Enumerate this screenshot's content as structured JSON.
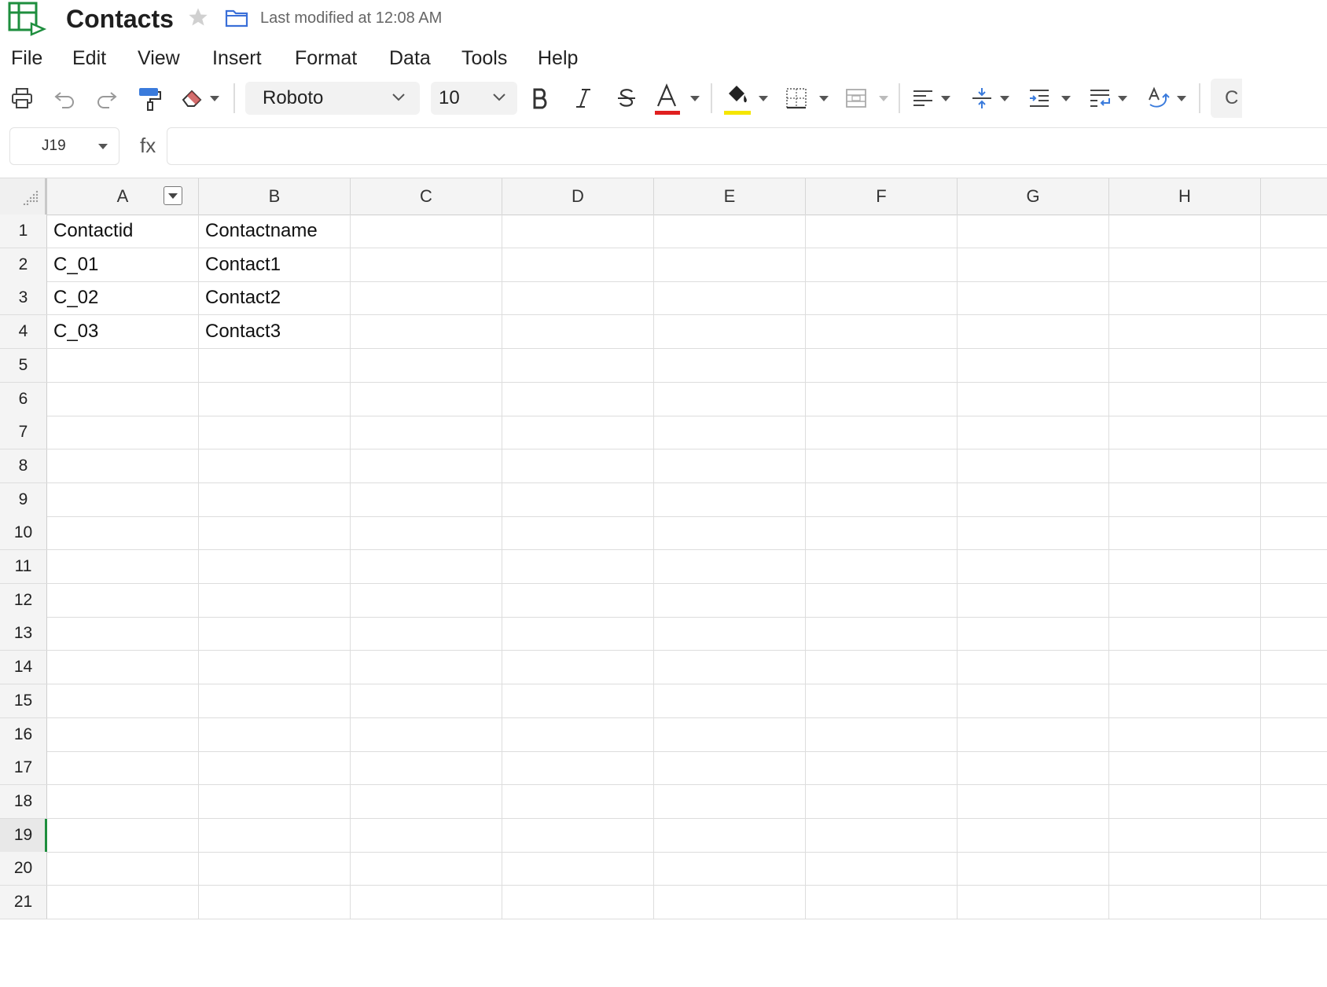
{
  "document": {
    "title": "Contacts",
    "last_modified": "Last modified at 12:08 AM"
  },
  "menu": [
    "File",
    "Edit",
    "View",
    "Insert",
    "Format",
    "Data",
    "Tools",
    "Help"
  ],
  "toolbar": {
    "font_family": "Roboto",
    "font_size": "10",
    "text_color": "#e02020",
    "fill_color": "#f5e600",
    "partial_right_edge": "C"
  },
  "formula_bar": {
    "cell_ref": "J19",
    "fx_label": "fx",
    "formula": ""
  },
  "sheet": {
    "columns": [
      "A",
      "B",
      "C",
      "D",
      "E",
      "F",
      "G",
      "H"
    ],
    "rows": [
      {
        "num": "1",
        "cells": [
          "Contactid",
          "Contactname"
        ]
      },
      {
        "num": "2",
        "cells": [
          "C_01",
          "Contact1"
        ]
      },
      {
        "num": "3",
        "cells": [
          "C_02",
          "Contact2"
        ]
      },
      {
        "num": "4",
        "cells": [
          "C_03",
          "Contact3"
        ]
      },
      {
        "num": "5",
        "cells": [
          "",
          ""
        ]
      },
      {
        "num": "6",
        "cells": [
          "",
          ""
        ]
      },
      {
        "num": "7",
        "cells": [
          "",
          ""
        ]
      },
      {
        "num": "8",
        "cells": [
          "",
          ""
        ]
      },
      {
        "num": "9",
        "cells": [
          "",
          ""
        ]
      },
      {
        "num": "10",
        "cells": [
          "",
          ""
        ]
      },
      {
        "num": "11",
        "cells": [
          "",
          ""
        ]
      },
      {
        "num": "12",
        "cells": [
          "",
          ""
        ]
      },
      {
        "num": "13",
        "cells": [
          "",
          ""
        ]
      },
      {
        "num": "14",
        "cells": [
          "",
          ""
        ]
      },
      {
        "num": "15",
        "cells": [
          "",
          ""
        ]
      },
      {
        "num": "16",
        "cells": [
          "",
          ""
        ]
      },
      {
        "num": "17",
        "cells": [
          "",
          ""
        ]
      },
      {
        "num": "18",
        "cells": [
          "",
          ""
        ]
      },
      {
        "num": "19",
        "cells": [
          "",
          ""
        ]
      },
      {
        "num": "20",
        "cells": [
          "",
          ""
        ]
      },
      {
        "num": "21",
        "cells": [
          "",
          ""
        ]
      }
    ],
    "active_row": "19",
    "filter_column": "A"
  },
  "accent_color": "#1e8e3e"
}
